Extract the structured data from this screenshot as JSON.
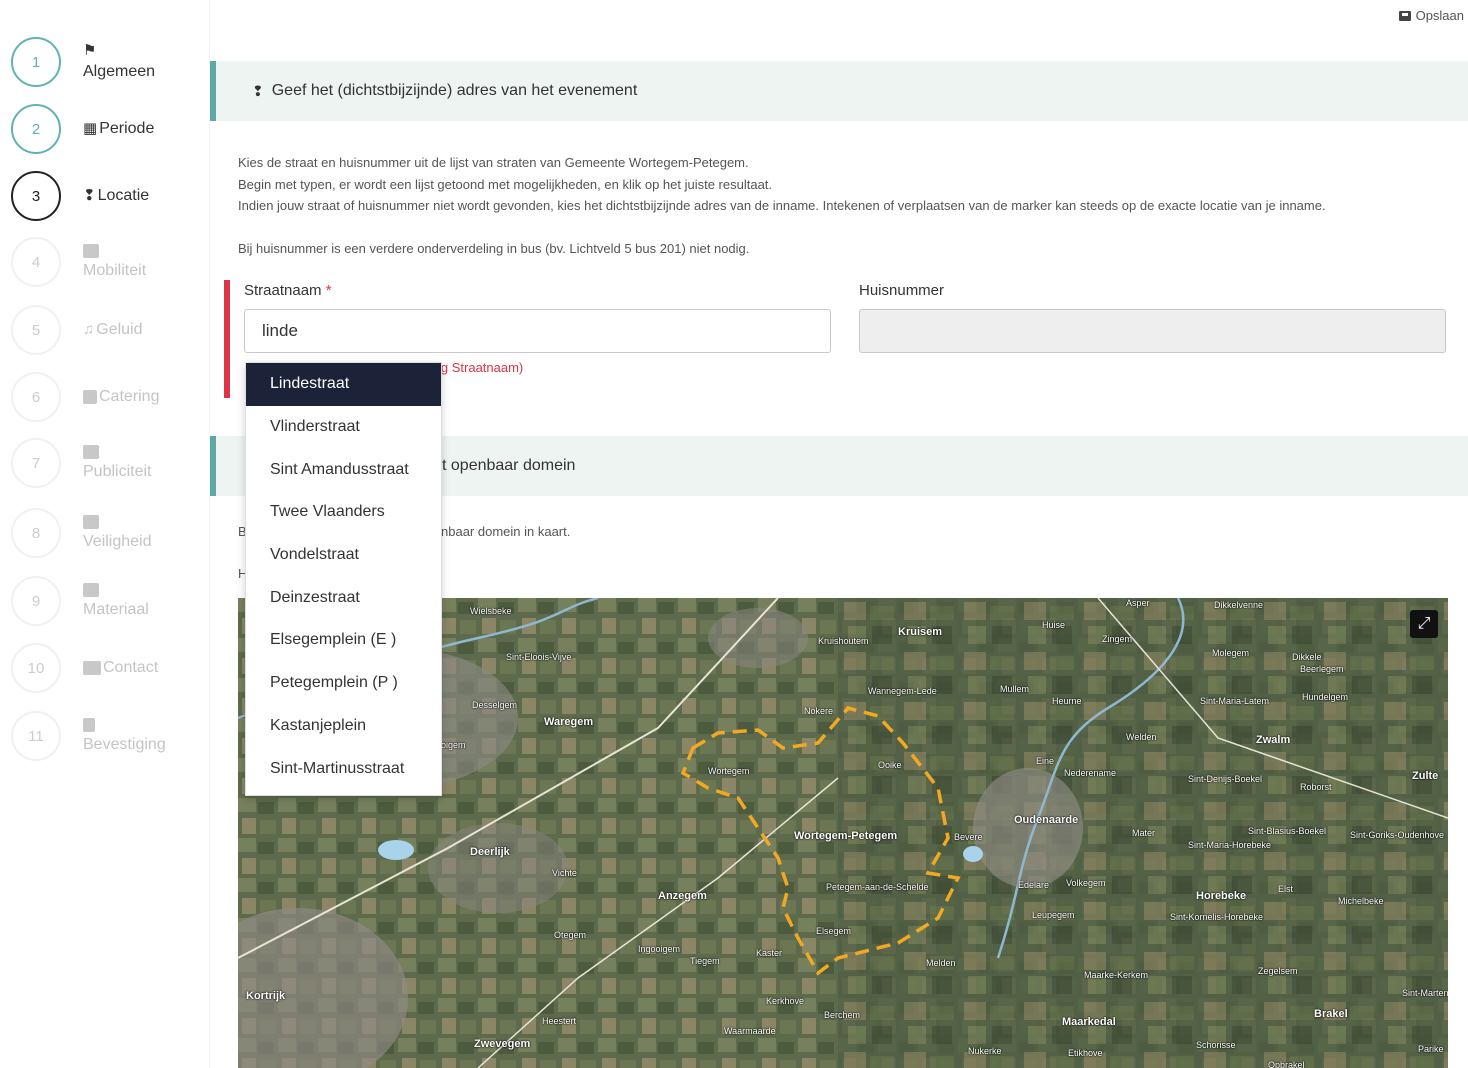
{
  "header": {
    "save_label": "Opslaan"
  },
  "steps": [
    {
      "num": "1",
      "label": "Algemeen",
      "icon": "⚑"
    },
    {
      "num": "2",
      "label": "Periode",
      "icon": "▦"
    },
    {
      "num": "3",
      "label": "Locatie",
      "icon": "❢"
    },
    {
      "num": "4",
      "label": "Mobiliteit",
      "icon": "car-icon"
    },
    {
      "num": "5",
      "label": "Geluid",
      "icon": "♫"
    },
    {
      "num": "6",
      "label": "Catering",
      "icon": "utensils-icon"
    },
    {
      "num": "7",
      "label": "Publiciteit",
      "icon": "ad-icon"
    },
    {
      "num": "8",
      "label": "Veiligheid",
      "icon": "users-icon"
    },
    {
      "num": "9",
      "label": "Materiaal",
      "icon": "box-icon"
    },
    {
      "num": "10",
      "label": "Contact",
      "icon": "address-card-icon"
    },
    {
      "num": "11",
      "label": "Bevestiging",
      "icon": "clipboard-check-icon"
    }
  ],
  "address_section": {
    "title": "Geef het (dichtstbijzijnde) adres van het evenement",
    "info_lines": [
      "Kies de straat en huisnummer uit de lijst van straten van Gemeente Wortegem-Petegem.",
      "Begin met typen, er wordt een lijst getoond met mogelijkheden, en klik op het juiste resultaat.",
      "Indien jouw straat of huisnummer niet wordt gevonden, kies het dichtstbijzijnde adres van de inname. Intekenen of verplaatsen van de marker kan steeds op de exacte locatie van je inname."
    ],
    "bus_note": "Bij huisnummer is een verdere onderverdeling in bus (bv. Lichtveld 5 bus 201) niet nodig.",
    "street_label": "Straatnaam",
    "required_mark": "*",
    "street_value": "linde",
    "house_label": "Huisnummer",
    "house_value": "",
    "error_visible": "ig Straatnaam)"
  },
  "domain_section": {
    "title_visible": "t openbaar domein",
    "desc_visible": "nbaar domein in kaart.",
    "desc_prefix": "B",
    "line_prefix": "H"
  },
  "dropdown": {
    "items": [
      "Lindestraat",
      "Vlinderstraat",
      "Sint Amandusstraat",
      "Twee Vlaanders",
      "Vondelstraat",
      "Deinzestraat",
      "Elsegemplein (E )",
      "Petegemplein (P )",
      "Kastanjeplein",
      "Sint-Martinusstraat"
    ],
    "selected_index": 0
  },
  "map": {
    "expand_icon": "⤢",
    "labels": [
      "Wielsbeke",
      "Sint-Eloois-Vijve",
      "Desselgem",
      "Waregem",
      "Kruishoutem",
      "Kruisem",
      "Huise",
      "Zingem",
      "Wannegem-Lede",
      "Nokere",
      "Mullem",
      "Ouwegem",
      "Wortegem",
      "Ooike",
      "Wortegem-Petegem",
      "Bevere",
      "Oudenaarde",
      "Nederename",
      "Eine",
      "Welden",
      "Zwalm",
      "Deerlijk",
      "Vichte",
      "Anzegem",
      "Petegem-aan-de-Schelde",
      "Elsegem",
      "Ingooigem",
      "Tiegem",
      "Kaster",
      "Otegem",
      "Kortrijk",
      "Kerkhove",
      "Melden",
      "Edelare",
      "Volkegem",
      "Leupegem",
      "Horebeke",
      "Maarkedal",
      "Maarke-Kerkem",
      "Brakel",
      "Zwevegem",
      "Waarmaarde",
      "Berchem",
      "Nukerke",
      "Etikhove",
      "Schorisse",
      "Zulte",
      "Heestert",
      "Molegem",
      "Dikkele",
      "Mater",
      "Sint-Maria-Horebeke",
      "Sint-Denijs-Boekel",
      "Roborst",
      "Sint-Maria-Latem",
      "Sint-Kornelis-Horebeke",
      "Zegelsem",
      "Michelbeke",
      "Elst",
      "Opbrakel",
      "Sint-Blasius-Boekel",
      "Hundelgem",
      "Beerlegem",
      "Dikkelvenne",
      "Asper",
      "Parike",
      "Sint-Martens-Lierde",
      "Sint-Goriks-Oudenhove",
      "Wannegem",
      "Heurne",
      "Ooigem"
    ]
  }
}
